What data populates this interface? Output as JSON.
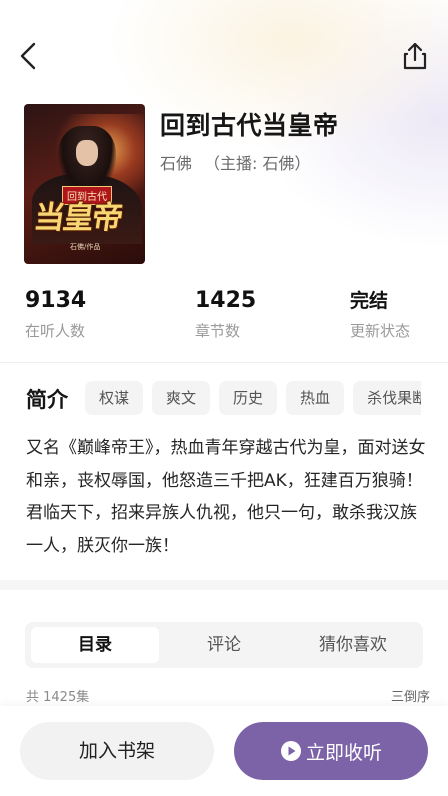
{
  "book": {
    "title": "回到古代当皇帝",
    "author": "石佛",
    "narrator_line": "（主播: 石佛）",
    "cover": {
      "tag": "回到古代",
      "big_title": "当皇帝",
      "author_tag": "石佛/作品"
    }
  },
  "stats": [
    {
      "value": "9134",
      "label": "在听人数"
    },
    {
      "value": "1425",
      "label": "章节数"
    },
    {
      "value": "完结",
      "label": "更新状态"
    }
  ],
  "intro": {
    "label": "简介",
    "tags": [
      "权谋",
      "爽文",
      "历史",
      "热血",
      "杀伐果断"
    ],
    "description": "又名《巅峰帝王》，热血青年穿越古代为皇，面对送女和亲，丧权辱国，他怒造三千把AK，狂建百万狼骑！君临天下，招来异族人仇视，他只一句，敢杀我汉族一人，朕灭你一族！"
  },
  "tabs": [
    {
      "label": "目录",
      "active": true
    },
    {
      "label": "评论",
      "active": false
    },
    {
      "label": "猜你喜欢",
      "active": false
    }
  ],
  "episodes": {
    "count_text": "共 1425集",
    "sort_label": "三倒序"
  },
  "actions": {
    "shelf_label": "加入书架",
    "listen_label": "立即收听"
  },
  "icons": {
    "back": "chevron-left-icon",
    "share": "share-icon",
    "play": "play-circle-icon"
  },
  "colors": {
    "accent": "#7c63a8",
    "muted_text": "#9a9a9a"
  }
}
